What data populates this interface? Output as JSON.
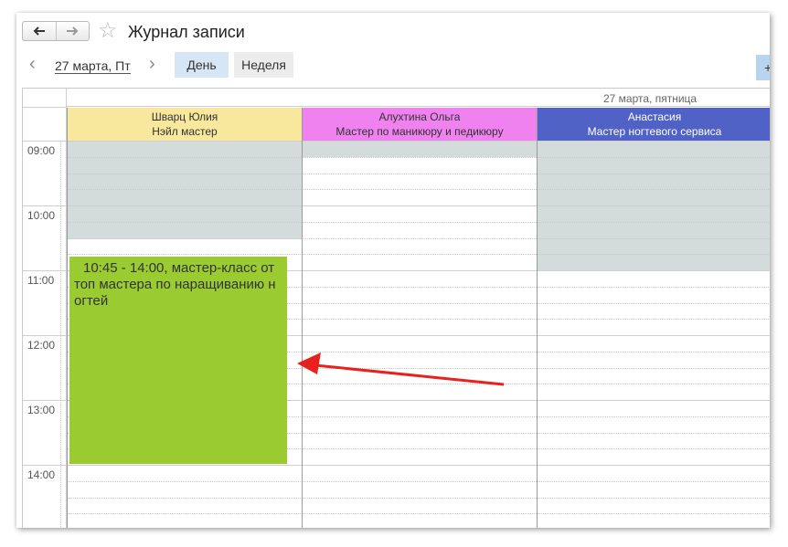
{
  "window": {
    "title": "Журнал записи"
  },
  "navigation": {
    "back_icon": "arrow-left-icon",
    "forward_icon": "arrow-right-icon",
    "favorite_icon": "star-icon"
  },
  "toolbar": {
    "prev_label": "‹",
    "date_label": "27 марта, Пт",
    "next_label": "›",
    "tab_day": "День",
    "tab_week": "Неделя",
    "add_label": "+"
  },
  "calendar": {
    "date_heading": "27 марта, пятница",
    "resources": [
      {
        "name": "Шварц Юлия",
        "role": "Нэйл мастер",
        "color": "#f8e89d"
      },
      {
        "name": "Алухтина Ольга",
        "role": "Мастер по маникюру и педикюру",
        "color": "#ef82ef"
      },
      {
        "name": "Анастасия",
        "role": "Мастер ногтевого сервиса",
        "color": "#5062c5"
      }
    ],
    "time_slots": [
      "09:00",
      "10:00",
      "11:00",
      "12:00",
      "13:00",
      "14:00"
    ],
    "busy_color": "#d3dcdb",
    "event": {
      "text": "10:45 - 14:00, мастер-класс от топ мастера по наращиванию ногтей",
      "line1": "10:45 - 14:00, мастер-класс от",
      "line2": "топ мастера по наращиванию н",
      "line3": "огтей",
      "color": "#9acc32"
    },
    "annotation_color": "#e8211c"
  }
}
